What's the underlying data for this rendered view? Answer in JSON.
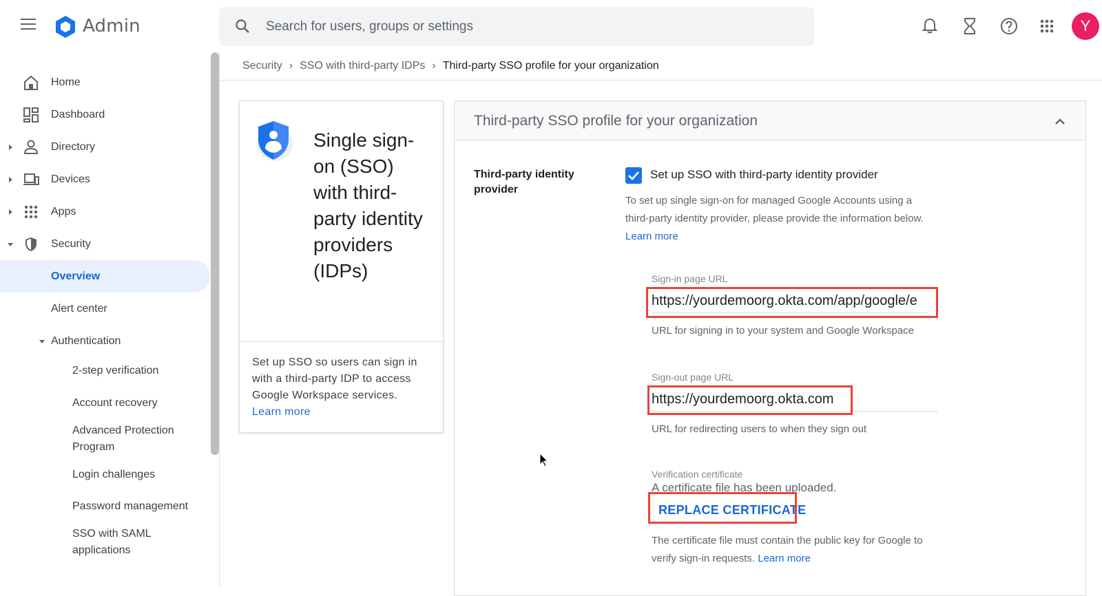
{
  "header": {
    "app_title": "Admin",
    "search_placeholder": "Search for users, groups or settings",
    "avatar_initial": "Y"
  },
  "sidebar": {
    "items": [
      {
        "label": "Home",
        "icon": "home-icon"
      },
      {
        "label": "Dashboard",
        "icon": "dashboard-icon"
      },
      {
        "label": "Directory",
        "icon": "person-icon"
      },
      {
        "label": "Devices",
        "icon": "devices-icon"
      },
      {
        "label": "Apps",
        "icon": "apps-grid-icon"
      },
      {
        "label": "Security",
        "icon": "shield-icon"
      }
    ],
    "security_sub": {
      "overview": "Overview",
      "alert_center": "Alert center",
      "authentication": "Authentication"
    },
    "auth_sub": [
      "2-step verification",
      "Account recovery",
      "Advanced Protection Program",
      "Login challenges",
      "Password management",
      "SSO with SAML applications"
    ]
  },
  "breadcrumb": {
    "items": [
      "Security",
      "SSO with third-party IDPs"
    ],
    "current": "Third-party SSO profile for your organization"
  },
  "info_card": {
    "title": "Single sign-on (SSO) with third-party identity providers (IDPs)",
    "description": "Set up SSO so users can sign in with a third-party IDP to access Google Workspace services.",
    "link": "Learn more"
  },
  "panel": {
    "title": "Third-party SSO profile for your organization",
    "section_label": "Third-party identity provider",
    "checkbox_label": "Set up SSO with third-party identity provider",
    "checkbox_checked": true,
    "help_text": "To set up single sign-on for managed Google Accounts using a third-party identity provider, please provide the information below.",
    "help_link": "Learn more",
    "sign_in": {
      "label": "Sign-in page URL",
      "value": "https://yourdemoorg.okta.com/app/google/e",
      "hint": "URL for signing in to your system and Google Workspace"
    },
    "sign_out": {
      "label": "Sign-out page URL",
      "value": "https://yourdemoorg.okta.com",
      "hint": "URL for redirecting users to when they sign out"
    },
    "certificate": {
      "label": "Verification certificate",
      "status": "A certificate file has been uploaded.",
      "button": "REPLACE CERTIFICATE",
      "help": "The certificate file must contain the public key for Google to verify sign-in requests.",
      "help_link": "Learn more"
    }
  },
  "colors": {
    "accent": "#1a73e8",
    "link": "#1967d2",
    "highlight": "#ea4335",
    "avatar": "#e91e63",
    "active_bg": "#e8f0fe"
  }
}
